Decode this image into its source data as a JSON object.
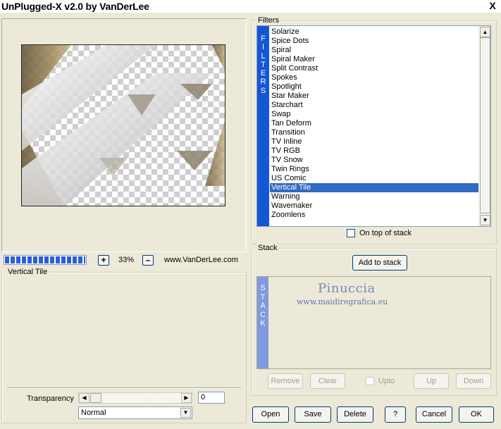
{
  "window": {
    "title": "UnPlugged-X v2.0 by VanDerLee",
    "close_glyph": "X"
  },
  "preview": {
    "progress": 1.0
  },
  "zoom": {
    "minus": "–",
    "plus": "+",
    "value": "33%"
  },
  "site": "www.VanDerLee.com",
  "filter_info": {
    "label": "Vertical Tile"
  },
  "transparency": {
    "label": "Transparency",
    "value": "0"
  },
  "blend_mode": {
    "value": "Normal"
  },
  "filters": {
    "group_label": "Filters",
    "vertical_label": [
      "F",
      "I",
      "L",
      "T",
      "E",
      "R",
      "S"
    ],
    "items": [
      "Solarize",
      "Spice Dots",
      "Spiral",
      "Spiral Maker",
      "Split Contrast",
      "Spokes",
      "Spotlight",
      "Star Maker",
      "Starchart",
      "Swap",
      "Tan Deform",
      "Transition",
      "TV Inline",
      "TV RGB",
      "TV Snow",
      "Twin Rings",
      "US Comic",
      "Vertical Tile",
      "Warning",
      "Wavemaker",
      "Zoomlens"
    ],
    "selected": "Vertical Tile",
    "on_top_label": "On top of stack",
    "accent": "#1556d6",
    "selection_color": "#316ac5"
  },
  "stack": {
    "group_label": "Stack",
    "add_label": "Add to stack",
    "vertical_label": [
      "S",
      "T",
      "A",
      "C",
      "K"
    ],
    "watermark_name": "Pinuccia",
    "watermark_url": "www.maidiregrafica.eu",
    "remove_label": "Remove",
    "clear_label": "Clear",
    "upto_label": "Upto",
    "up_label": "Up",
    "down_label": "Down"
  },
  "footer": {
    "open_label": "Open",
    "save_label": "Save",
    "delete_label": "Delete",
    "help_label": "?",
    "cancel_label": "Cancel",
    "ok_label": "OK"
  }
}
